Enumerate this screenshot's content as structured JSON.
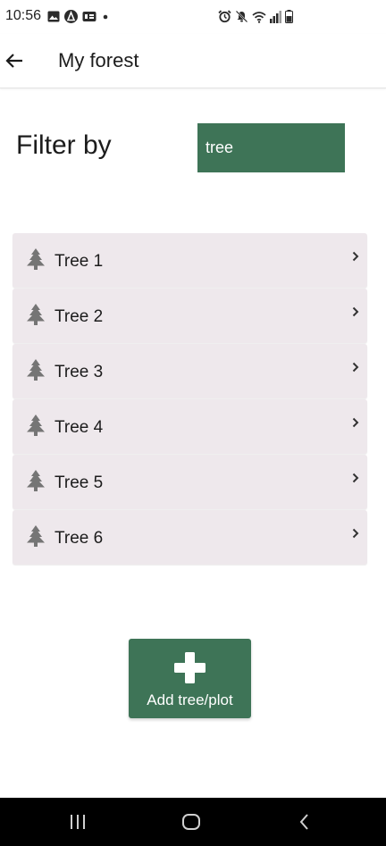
{
  "status_bar": {
    "time": "10:56",
    "left_icons": [
      "gallery-icon",
      "app-icon",
      "sdcard-icon",
      "dot-icon"
    ],
    "right_icons": [
      "alarm-icon",
      "mute-icon",
      "wifi-icon",
      "signal-icon",
      "battery-icon"
    ]
  },
  "app_bar": {
    "title": "My forest",
    "back_icon": "arrow-left-icon"
  },
  "filter": {
    "label": "Filter by",
    "value": "tree",
    "background": "#3e7457"
  },
  "trees": [
    {
      "label": "Tree 1"
    },
    {
      "label": "Tree 2"
    },
    {
      "label": "Tree 3"
    },
    {
      "label": "Tree 4"
    },
    {
      "label": "Tree 5"
    },
    {
      "label": "Tree 6"
    }
  ],
  "add_button": {
    "label": "Add tree/plot",
    "icon": "plus-icon"
  },
  "nav_bar": {
    "buttons": [
      "recent-apps-icon",
      "home-icon",
      "back-icon"
    ]
  },
  "colors": {
    "accent": "#3e7457",
    "list_item_bg": "#eee8ec",
    "icon_gray": "#757575"
  }
}
